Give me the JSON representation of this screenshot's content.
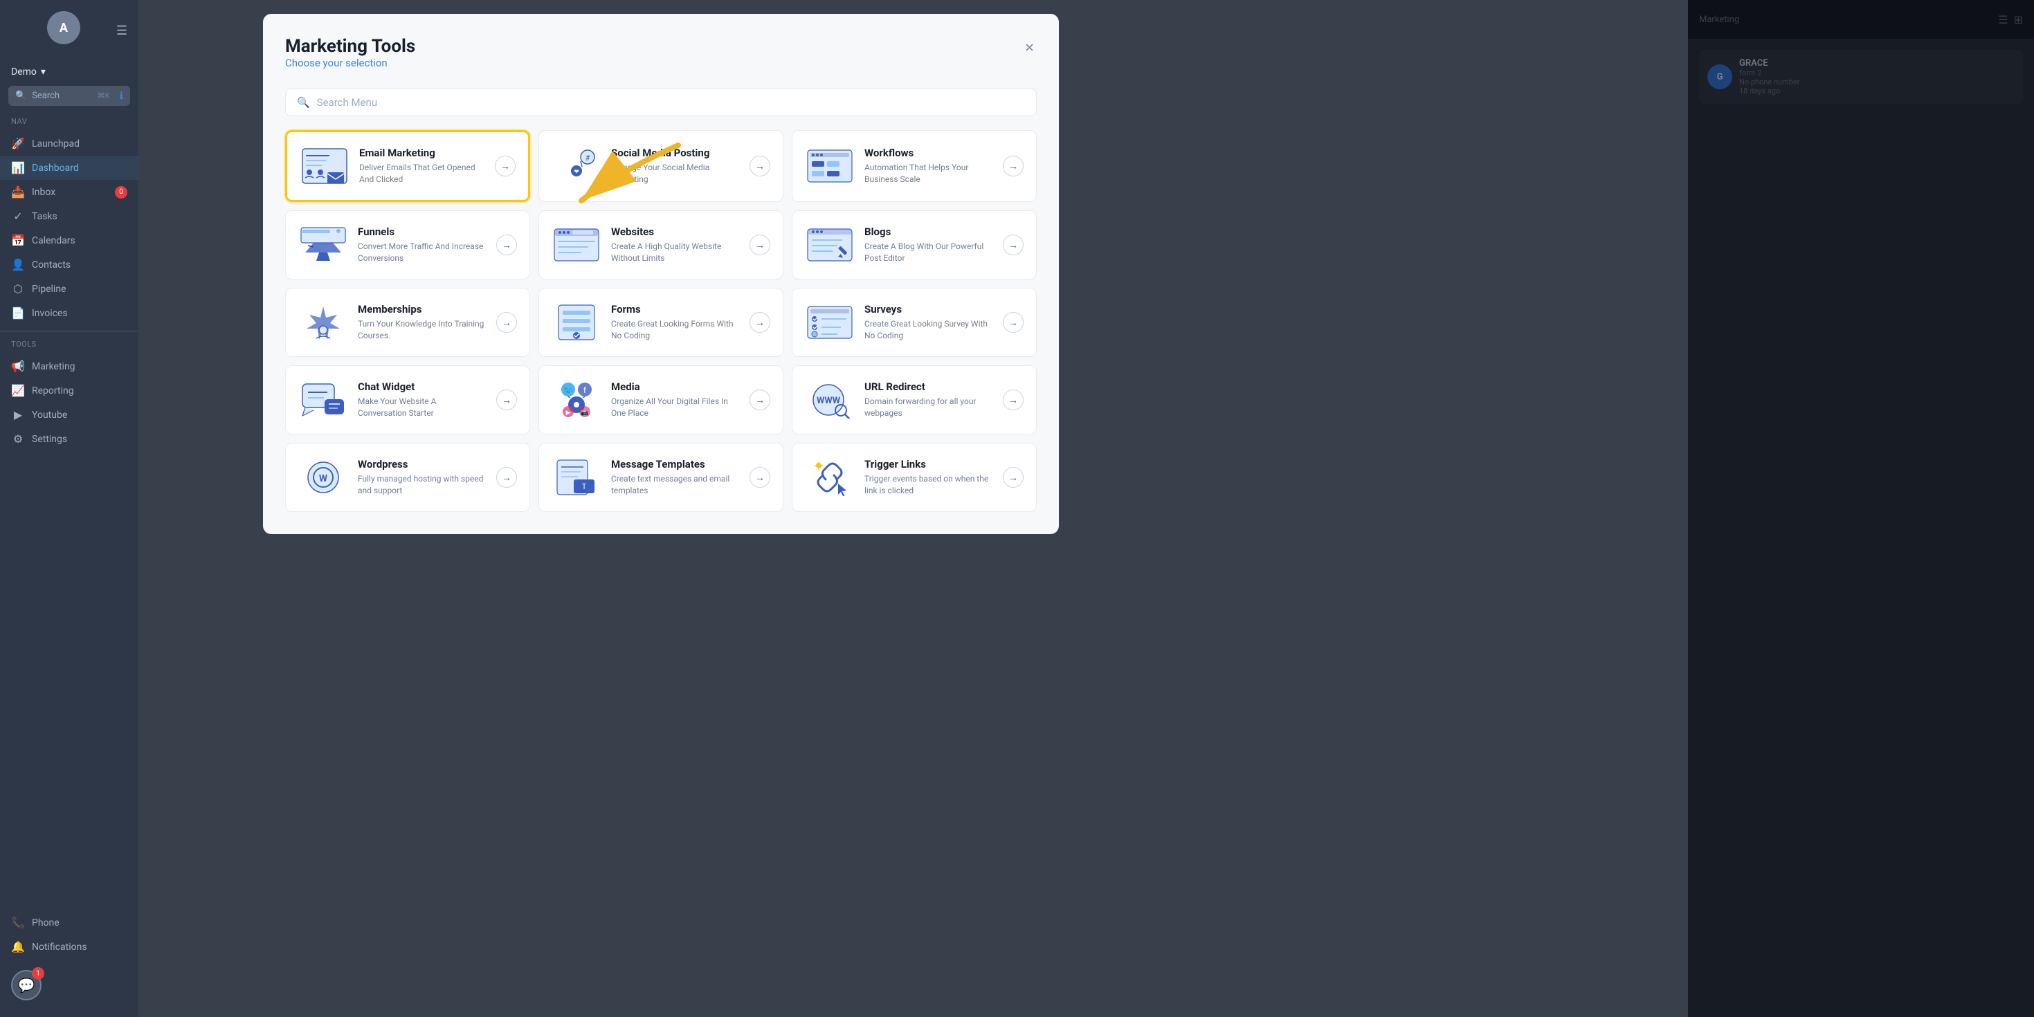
{
  "sidebar": {
    "avatar_letter": "A",
    "menu_label": "Demo",
    "search_label": "Search",
    "search_shortcut": "⌘K",
    "sections": [
      {
        "label": "Nav",
        "items": [
          {
            "id": "launchpad",
            "label": "Launchpad",
            "icon": "🚀",
            "active": false
          },
          {
            "id": "dashboard",
            "label": "Dashboard",
            "icon": "📊",
            "active": true
          },
          {
            "id": "inbox",
            "label": "Inbox",
            "icon": "📥",
            "active": false,
            "badge": "0"
          },
          {
            "id": "tasks",
            "label": "Tasks",
            "icon": "✓",
            "active": false
          },
          {
            "id": "calendars",
            "label": "Calendars",
            "icon": "📅",
            "active": false
          },
          {
            "id": "contacts",
            "label": "Contacts",
            "icon": "👤",
            "active": false
          },
          {
            "id": "pipeline",
            "label": "Pipeline",
            "icon": "⬡",
            "active": false
          },
          {
            "id": "invoices",
            "label": "Invoices",
            "icon": "📄",
            "active": false
          }
        ]
      },
      {
        "label": "Tools",
        "items": [
          {
            "id": "marketing",
            "label": "Marketing",
            "icon": "📢",
            "active": false
          },
          {
            "id": "reporting",
            "label": "Reporting",
            "icon": "📈",
            "active": false
          },
          {
            "id": "youtube",
            "label": "Youtube",
            "icon": "▶",
            "active": false
          },
          {
            "id": "settings",
            "label": "Settings",
            "icon": "⚙",
            "active": false
          }
        ]
      }
    ],
    "bottom_items": [
      {
        "id": "phone",
        "label": "Phone",
        "icon": "📞",
        "active": false
      },
      {
        "id": "notifications",
        "label": "Notifications",
        "icon": "🔔",
        "active": false
      }
    ],
    "chat_badge": "1"
  },
  "modal": {
    "title": "Marketing Tools",
    "subtitle": "Choose your selection",
    "close_label": "×",
    "search_placeholder": "Search Menu",
    "tools": [
      {
        "id": "email-marketing",
        "name": "Email Marketing",
        "desc": "Deliver Emails That Get Opened And Clicked",
        "highlighted": true,
        "col": 0
      },
      {
        "id": "social-media",
        "name": "Social Media Posting",
        "desc": "Manage Your Social Media Marketing",
        "highlighted": false,
        "col": 1
      },
      {
        "id": "workflows",
        "name": "Workflows",
        "desc": "Automation That Helps Your Business Scale",
        "highlighted": false,
        "col": 2
      },
      {
        "id": "funnels",
        "name": "Funnels",
        "desc": "Convert More Traffic And Increase Conversions",
        "highlighted": false,
        "col": 0
      },
      {
        "id": "websites",
        "name": "Websites",
        "desc": "Create A High Quality Website Without Limits",
        "highlighted": false,
        "col": 1
      },
      {
        "id": "blogs",
        "name": "Blogs",
        "desc": "Create A Blog With Our Powerful Post Editor",
        "highlighted": false,
        "col": 2
      },
      {
        "id": "memberships",
        "name": "Memberships",
        "desc": "Turn Your Knowledge Into Training Courses.",
        "highlighted": false,
        "col": 0
      },
      {
        "id": "forms",
        "name": "Forms",
        "desc": "Create Great Looking Forms With No Coding",
        "highlighted": false,
        "col": 1
      },
      {
        "id": "surveys",
        "name": "Surveys",
        "desc": "Create Great Looking Survey With No Coding",
        "highlighted": false,
        "col": 2
      },
      {
        "id": "chat-widget",
        "name": "Chat Widget",
        "desc": "Make Your Website A Conversation Starter",
        "highlighted": false,
        "col": 0
      },
      {
        "id": "media",
        "name": "Media",
        "desc": "Organize All Your Digital Files In One Place",
        "highlighted": false,
        "col": 1
      },
      {
        "id": "url-redirect",
        "name": "URL Redirect",
        "desc": "Domain forwarding for all your webpages",
        "highlighted": false,
        "col": 2
      },
      {
        "id": "wordpress",
        "name": "Wordpress",
        "desc": "Fully managed hosting with speed and support",
        "highlighted": false,
        "col": 0
      },
      {
        "id": "message-templates",
        "name": "Message Templates",
        "desc": "Create text messages and email templates",
        "highlighted": false,
        "col": 1
      },
      {
        "id": "trigger-links",
        "name": "Trigger Links",
        "desc": "Trigger events based on when the link is clicked",
        "highlighted": false,
        "col": 2
      }
    ],
    "arrow_label": "←"
  },
  "colors": {
    "highlight_border": "#f6c90e",
    "accent_blue": "#3b5fc0",
    "light_blue": "#4f6fcc",
    "arrow_yellow": "#f0b429"
  }
}
